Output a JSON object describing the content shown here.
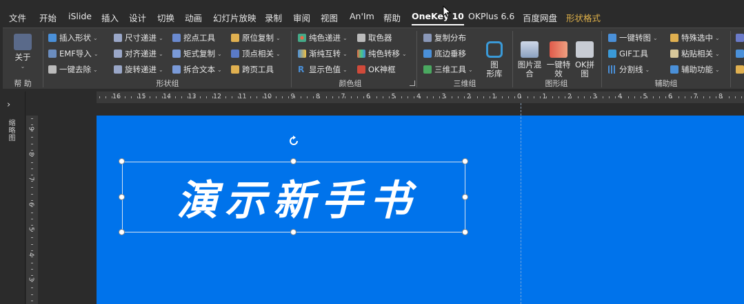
{
  "menu": {
    "items": [
      "文件",
      "开始",
      "iSlide",
      "插入",
      "设计",
      "切换",
      "动画",
      "幻灯片放映",
      "录制",
      "审阅",
      "视图",
      "An'Im",
      "帮助",
      "OneKey 10",
      "OKPlus 6.6",
      "百度网盘",
      "形状格式"
    ],
    "active": "OneKey 10",
    "context_tab": "形状格式"
  },
  "ribbon": {
    "help_group": {
      "button": "关于",
      "label": "帮 助"
    },
    "shape_group": {
      "label": "形状组",
      "buttons": [
        "插入形状",
        "尺寸递进",
        "挖点工具",
        "原位复制",
        "EMF导入",
        "对齐递进",
        "矩式复制",
        "顶点相关",
        "一键去除",
        "旋转递进",
        "拆合文本",
        "跨页工具"
      ]
    },
    "color_group": {
      "label": "颜色组",
      "buttons": [
        "纯色递进",
        "取色器",
        "渐纯互转",
        "纯色转移",
        "显示色值",
        "OK神框"
      ]
    },
    "3d_group": {
      "label": "三维组",
      "buttons": [
        "复制分布",
        "底边垂移",
        "三维工具"
      ],
      "big_button": "图\n形库"
    },
    "graphic_group": {
      "label": "图形组",
      "big_buttons": [
        "图片混\n合",
        "一键特\n效",
        "OK拼\n图"
      ]
    },
    "aux_group": {
      "label": "辅助组",
      "buttons": [
        "一键转图",
        "特殊选中",
        "GIF工具",
        "粘贴相关",
        "分割线",
        "辅助功能"
      ]
    }
  },
  "left_pane": {
    "label": "缩略图"
  },
  "ruler": {
    "horizontal": [
      "16",
      "15",
      "14",
      "13",
      "12",
      "11",
      "10",
      "9",
      "8",
      "7",
      "6",
      "5",
      "4",
      "3",
      "2",
      "1",
      "0",
      "1",
      "2",
      "3",
      "4",
      "5",
      "6",
      "7",
      "8"
    ],
    "vertical": [
      "9",
      "8",
      "7",
      "6",
      "5",
      "4",
      "3"
    ]
  },
  "slide": {
    "title": "演示新手书",
    "background": "#0073eb",
    "text_color": "#ffffff"
  },
  "colors": {
    "menubar": "#2b2b2b",
    "ribbon": "#3a3a3a",
    "accent_context": "#e2b34a"
  }
}
